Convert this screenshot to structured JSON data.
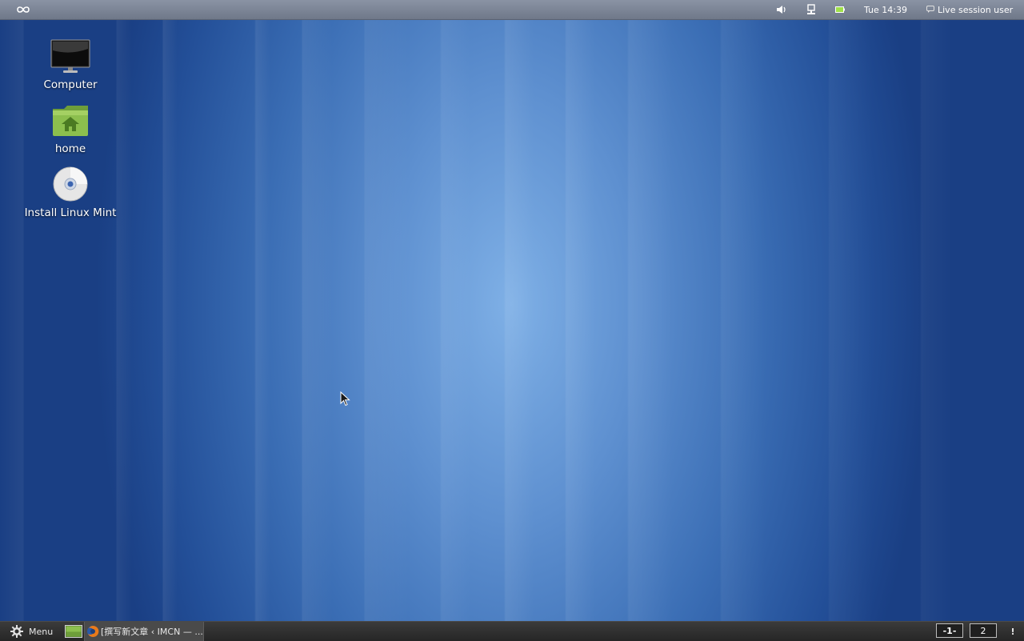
{
  "top_panel": {
    "logo_icon": "infinity-logo-icon",
    "tray_icons": [
      "volume-icon",
      "network-icon",
      "battery-icon"
    ],
    "clock": "Tue 14:39",
    "user_label": "Live session user",
    "user_icon": "user-chat-icon"
  },
  "desktop": {
    "icons": [
      {
        "label": "Computer",
        "icon": "monitor-icon"
      },
      {
        "label": "home",
        "icon": "home-folder-icon"
      },
      {
        "label": "Install Linux Mint",
        "icon": "disc-icon"
      }
    ]
  },
  "bottom_panel": {
    "menu_label": "Menu",
    "menu_icon": "gear-icon",
    "show_desktop_icon": "show-desktop-icon",
    "taskbar": [
      {
        "title": "[撰写新文章 ‹ IMCN — ...",
        "icon": "firefox-icon"
      }
    ],
    "workspaces": [
      "-1-",
      "2"
    ],
    "notification_label": "!"
  },
  "colors": {
    "top_panel": "#7d8697",
    "bottom_panel": "#2f2f2f",
    "desktop_center": "#7fb0e6",
    "desktop_edge": "#1a3f84"
  }
}
